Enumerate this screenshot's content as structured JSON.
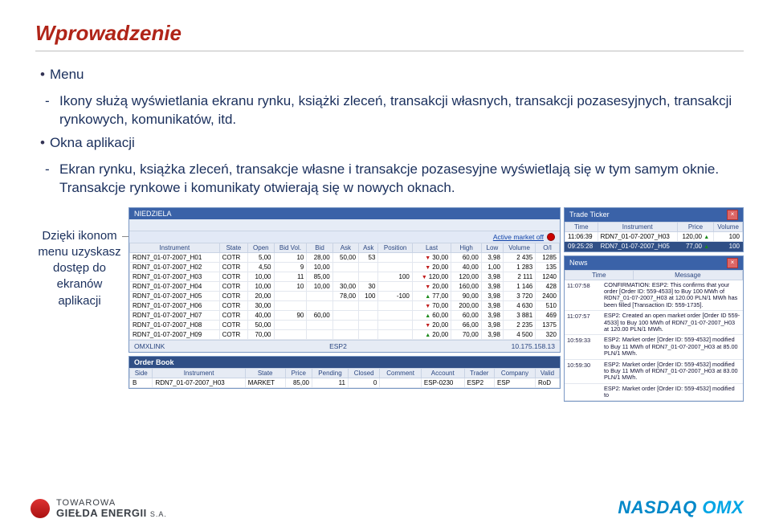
{
  "title": "Wprowadzenie",
  "bullets": {
    "b1_lead": "Menu",
    "b1_sub": "Ikony służą wyświetlania ekranu rynku, książki zleceń, transakcji własnych, transakcji pozasesyjnych, transakcji rynkowych, komunikatów, itd.",
    "b2_lead": "Okna aplikacji",
    "b2_sub": "Ekran rynku, książka zleceń, transakcje własne i transakcje pozasesyjne wyświetlają się w tym samym oknie. Transakcje rynkowe i komunikaty otwierają się w nowych oknach."
  },
  "callout": "Dzięki ikonom menu uzyskasz dostęp do ekranów aplikacji",
  "market": {
    "title": "NIEDZIELA",
    "toolbar_label": "Active market off",
    "headers": [
      "Instrument",
      "State",
      "Open",
      "Bid Vol.",
      "Bid",
      "Ask",
      "Ask",
      "Position",
      "Last",
      "High",
      "Low",
      "Volume",
      "O/I"
    ],
    "rows": [
      [
        "RDN7_01-07-2007_H01",
        "COTR",
        "5,00",
        "10",
        "28,00",
        "50,00",
        "53",
        "",
        "30,00",
        "60,00",
        "3,98",
        "2 435",
        "1285"
      ],
      [
        "RDN7_01-07-2007_H02",
        "COTR",
        "4,50",
        "9",
        "10,00",
        "",
        "",
        "",
        "20,00",
        "40,00",
        "1,00",
        "1 283",
        "135"
      ],
      [
        "RDN7_01-07-2007_H03",
        "COTR",
        "10,00",
        "11",
        "85,00",
        "",
        "",
        "100",
        "120,00",
        "120,00",
        "3,98",
        "2 111",
        "1240"
      ],
      [
        "RDN7_01-07-2007_H04",
        "COTR",
        "10,00",
        "10",
        "10,00",
        "30,00",
        "30",
        "",
        "20,00",
        "160,00",
        "3,98",
        "1 146",
        "428"
      ],
      [
        "RDN7_01-07-2007_H05",
        "COTR",
        "20,00",
        "",
        "",
        "78,00",
        "100",
        "-100",
        "77,00",
        "90,00",
        "3,98",
        "3 720",
        "2400"
      ],
      [
        "RDN7_01-07-2007_H06",
        "COTR",
        "30,00",
        "",
        "",
        "",
        "",
        "",
        "70,00",
        "200,00",
        "3,98",
        "4 630",
        "510"
      ],
      [
        "RDN7_01-07-2007_H07",
        "COTR",
        "40,00",
        "90",
        "60,00",
        "",
        "",
        "",
        "60,00",
        "60,00",
        "3,98",
        "3 881",
        "469"
      ],
      [
        "RDN7_01-07-2007_H08",
        "COTR",
        "50,00",
        "",
        "",
        "",
        "",
        "",
        "20,00",
        "66,00",
        "3,98",
        "2 235",
        "1375"
      ],
      [
        "RDN7_01-07-2007_H09",
        "COTR",
        "70,00",
        "",
        "",
        "",
        "",
        "",
        "20,00",
        "70,00",
        "3,98",
        "4 500",
        "320"
      ]
    ],
    "status_left": "OMXLINK",
    "status_mid": "ESP2",
    "status_right": "10.175.158.13"
  },
  "orderbook": {
    "title": "Order Book",
    "headers": [
      "Side",
      "Instrument",
      "State",
      "Price",
      "Pending",
      "Closed",
      "Comment",
      "Account",
      "Trader",
      "Company",
      "Valid"
    ],
    "row": [
      "B",
      "RDN7_01-07-2007_H03",
      "MARKET",
      "85,00",
      "11",
      "0",
      "",
      "ESP-0230",
      "ESP2",
      "ESP",
      "RoD"
    ]
  },
  "ticker": {
    "title": "Trade Ticker",
    "headers": [
      "Time",
      "Instrument",
      "Price",
      "Volume"
    ],
    "rows": [
      [
        "11:06:39",
        "RDN7_01-07-2007_H03",
        "120,00",
        "100"
      ],
      [
        "09:25:28",
        "RDN7_01-07-2007_H05",
        "77,00",
        "100"
      ]
    ]
  },
  "news": {
    "title": "News",
    "headers": [
      "Time",
      "Message"
    ],
    "rows": [
      [
        "11:07:58",
        "CONFIRMATION: ESP2: This confirms that your order [Order ID: 559-4533] to Buy 100 MWh of RDN7_01-07-2007_H03 at 120.00 PLN/1 MWh has been filled [Transaction ID: 559-1735]."
      ],
      [
        "11:07:57",
        "ESP2: Created an open market order [Order ID 559-4533] to Buy 100 MWh of RDN7_01-07-2007_H03 at 120.00 PLN/1 MWh."
      ],
      [
        "10:59:33",
        "ESP2: Market order [Order ID: 559-4532] modified to Buy 11 MWh of RDN7_01-07-2007_H03 at 85.00 PLN/1 MWh."
      ],
      [
        "10:59:30",
        "ESP2: Market order [Order ID: 559-4532] modified to Buy 11 MWh of RDN7_01-07-2007_H03 at 83.00 PLN/1 MWh."
      ],
      [
        "",
        "ESP2: Market order [Order ID: 559-4532] modified to"
      ]
    ]
  },
  "footer": {
    "tge_l1": "TOWAROWA",
    "tge_l2": "GIEŁDA ENERGII",
    "tge_sa": "S.A.",
    "nasdaq": "NASDAQ",
    "omx": "OMX"
  }
}
